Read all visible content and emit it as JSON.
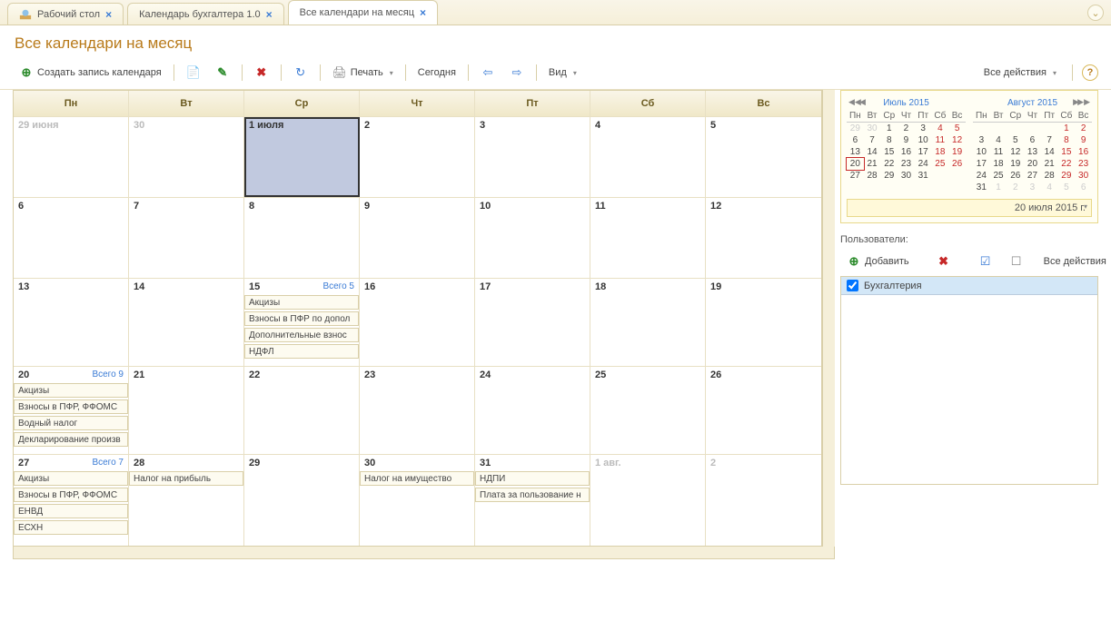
{
  "tabs": [
    {
      "label": "Рабочий стол",
      "active": false,
      "icon": true
    },
    {
      "label": "Календарь бухгалтера 1.0",
      "active": false,
      "icon": false
    },
    {
      "label": "Все календари на месяц",
      "active": true,
      "icon": false
    }
  ],
  "page_title": "Все календари на месяц",
  "toolbar": {
    "create": "Создать запись календаря",
    "print": "Печать",
    "today": "Сегодня",
    "view": "Вид",
    "all_actions": "Все действия"
  },
  "weekdays": [
    "Пн",
    "Вт",
    "Ср",
    "Чт",
    "Пт",
    "Сб",
    "Вс"
  ],
  "weeks": [
    [
      {
        "label": "29 июня",
        "faded": true
      },
      {
        "label": "30",
        "faded": true
      },
      {
        "label": "1 июля",
        "today": true
      },
      {
        "label": "2"
      },
      {
        "label": "3"
      },
      {
        "label": "4"
      },
      {
        "label": "5"
      }
    ],
    [
      {
        "label": "6"
      },
      {
        "label": "7"
      },
      {
        "label": "8"
      },
      {
        "label": "9"
      },
      {
        "label": "10"
      },
      {
        "label": "11"
      },
      {
        "label": "12"
      }
    ],
    [
      {
        "label": "13"
      },
      {
        "label": "14"
      },
      {
        "label": "15",
        "total": "Всего 5",
        "events": [
          "Акцизы",
          "Взносы в ПФР по допол",
          "Дополнительные взнос",
          "НДФЛ"
        ]
      },
      {
        "label": "16"
      },
      {
        "label": "17"
      },
      {
        "label": "18"
      },
      {
        "label": "19"
      }
    ],
    [
      {
        "label": "20",
        "total": "Всего 9",
        "events": [
          "Акцизы",
          "Взносы в ПФР, ФФОМС",
          "Водный налог",
          "Декларирование произв"
        ]
      },
      {
        "label": "21"
      },
      {
        "label": "22"
      },
      {
        "label": "23"
      },
      {
        "label": "24"
      },
      {
        "label": "25"
      },
      {
        "label": "26"
      }
    ],
    [
      {
        "label": "27",
        "total": "Всего 7",
        "events": [
          "Акцизы",
          "Взносы в ПФР, ФФОМС",
          "ЕНВД",
          "ЕСХН"
        ]
      },
      {
        "label": "28",
        "events": [
          "Налог на прибыль"
        ]
      },
      {
        "label": "29"
      },
      {
        "label": "30",
        "events": [
          "Налог на имущество"
        ]
      },
      {
        "label": "31",
        "events": [
          "НДПИ",
          "Плата за пользование н"
        ]
      },
      {
        "label": "1 авг.",
        "faded": true
      },
      {
        "label": "2",
        "faded": true
      }
    ]
  ],
  "mini": {
    "left": {
      "title": "Июль 2015",
      "head": [
        "Пн",
        "Вт",
        "Ср",
        "Чт",
        "Пт",
        "Сб",
        "Вс"
      ],
      "rows": [
        [
          "29f",
          "30f",
          "1",
          "2",
          "3",
          "4w",
          "5w"
        ],
        [
          "6",
          "7",
          "8",
          "9",
          "10",
          "11w",
          "12w"
        ],
        [
          "13",
          "14",
          "15",
          "16",
          "17",
          "18w",
          "19w"
        ],
        [
          "20t",
          "21",
          "22",
          "23",
          "24",
          "25w",
          "26w"
        ],
        [
          "27",
          "28",
          "29",
          "30",
          "31",
          "",
          ""
        ]
      ]
    },
    "right": {
      "title": "Август 2015",
      "head": [
        "Пн",
        "Вт",
        "Ср",
        "Чт",
        "Пт",
        "Сб",
        "Вс"
      ],
      "rows": [
        [
          "",
          "",
          "",
          "",
          "",
          "1w",
          "2w"
        ],
        [
          "3",
          "4",
          "5",
          "6",
          "7",
          "8w",
          "9w"
        ],
        [
          "10",
          "11",
          "12",
          "13",
          "14",
          "15w",
          "16w"
        ],
        [
          "17",
          "18",
          "19",
          "20",
          "21",
          "22w",
          "23w"
        ],
        [
          "24",
          "25",
          "26",
          "27",
          "28",
          "29w",
          "30w"
        ],
        [
          "31",
          "1f",
          "2f",
          "3f",
          "4f",
          "5f",
          "6f"
        ]
      ]
    },
    "date_field": "20 июля 2015 г."
  },
  "users": {
    "label": "Пользователи:",
    "add": "Добавить",
    "all_actions": "Все действия",
    "list": [
      {
        "name": "Бухгалтерия",
        "checked": true
      }
    ]
  }
}
